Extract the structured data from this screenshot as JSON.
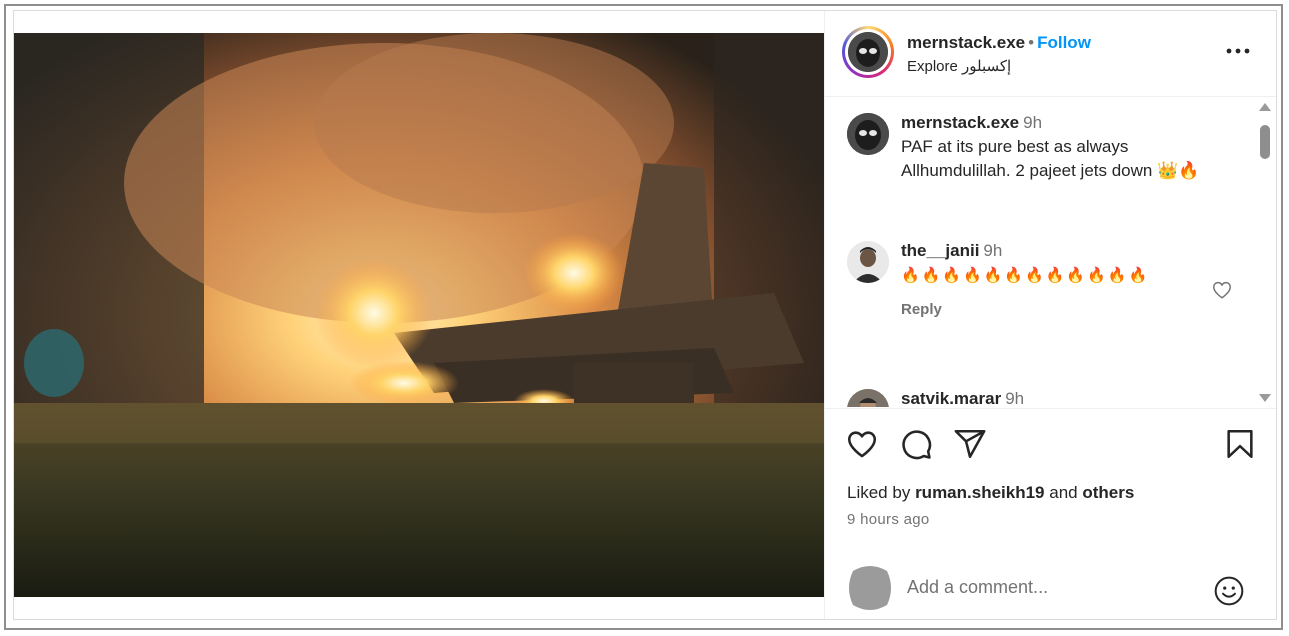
{
  "post": {
    "media_alt": "burning jet at night",
    "author": {
      "username": "mernstack.exe",
      "separator": "•",
      "follow_label": "Follow",
      "subtitle": "Explore إكسبلور"
    },
    "more_icon": "more-horizontal-icon"
  },
  "comments": [
    {
      "username": "mernstack.exe",
      "time": "9h",
      "text": "PAF at its pure best as always Allhumdulillah. 2 pajeet jets down 👑🔥"
    },
    {
      "username": "the__janii",
      "time": "9h",
      "text": "🔥🔥🔥🔥🔥🔥🔥🔥🔥🔥🔥🔥",
      "reply_label": "Reply"
    },
    {
      "username": "satvik.marar",
      "time": "9h"
    }
  ],
  "actions": {
    "icons": [
      "heart-icon",
      "comment-icon",
      "share-icon",
      "bookmark-icon"
    ],
    "liked_prefix": "Liked by",
    "liked_user": "ruman.sheikh19",
    "liked_and": "and",
    "liked_others": "others",
    "time_ago": "9 hours ago",
    "comment_placeholder": "Add a comment..."
  },
  "colors": {
    "accent": "#0095f6",
    "text": "#262626",
    "muted": "#737373"
  }
}
